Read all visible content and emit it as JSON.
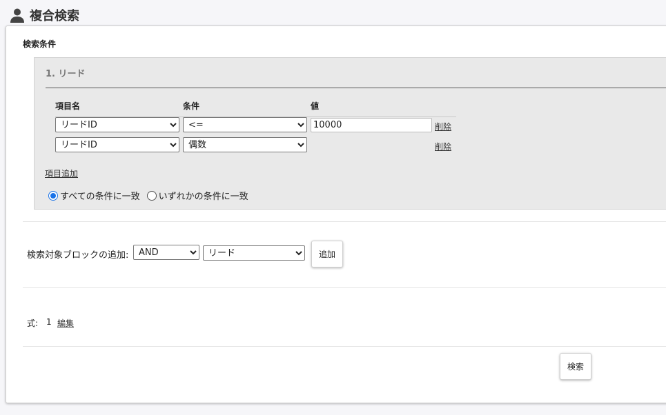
{
  "header": {
    "title": "複合検索",
    "icon": "user-icon"
  },
  "section": {
    "label": "検索条件"
  },
  "block": {
    "title": "1. リード",
    "columns": {
      "field": "項目名",
      "condition": "条件",
      "value": "値"
    },
    "rows": [
      {
        "field": "リードID",
        "condition": "<=",
        "value": "10000",
        "delete_label": "削除"
      },
      {
        "field": "リードID",
        "condition": "偶数",
        "value": "",
        "delete_label": "削除"
      }
    ],
    "add_item_label": "項目追加",
    "match": {
      "all_label": "すべての条件に一致",
      "any_label": "いずれかの条件に一致",
      "selected": "all"
    }
  },
  "add_block": {
    "label": "検索対象ブロックの追加:",
    "operator": "AND",
    "target": "リード",
    "button_label": "追加"
  },
  "formula": {
    "label": "式:",
    "value": "1",
    "edit_label": "編集"
  },
  "search_button_label": "検索",
  "colors": {
    "accent": "#1a73e8",
    "block_bg": "#e9e9e9"
  }
}
